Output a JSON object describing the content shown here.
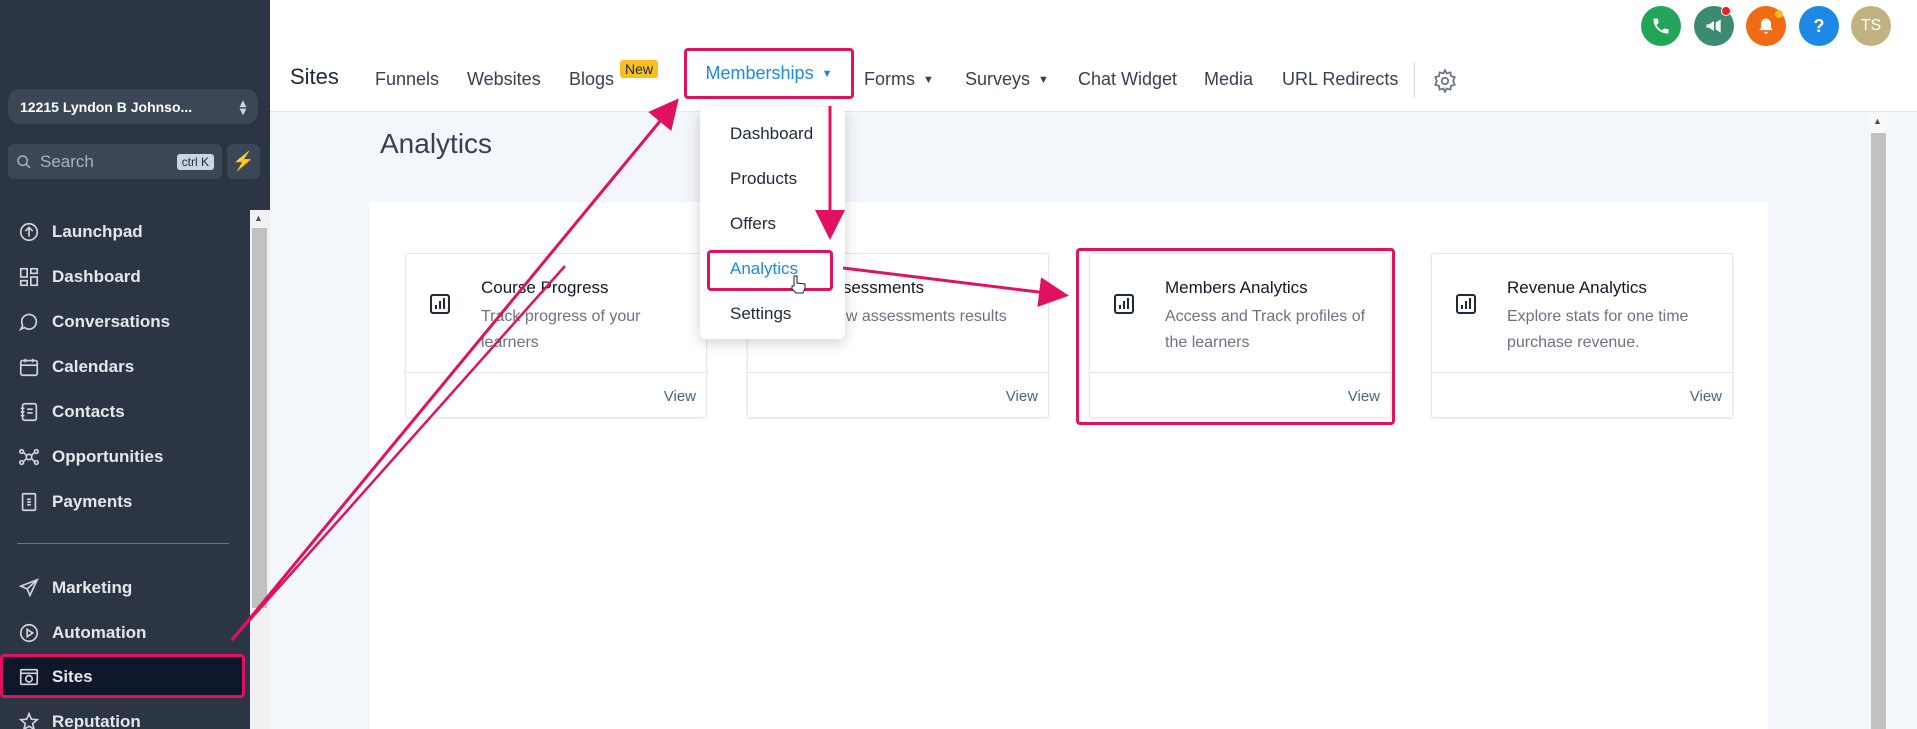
{
  "sidebar": {
    "location": "12215 Lyndon B Johnso...",
    "search_placeholder": "Search",
    "search_shortcut": "ctrl K",
    "items": [
      {
        "label": "Launchpad"
      },
      {
        "label": "Dashboard"
      },
      {
        "label": "Conversations"
      },
      {
        "label": "Calendars"
      },
      {
        "label": "Contacts"
      },
      {
        "label": "Opportunities"
      },
      {
        "label": "Payments"
      },
      {
        "label": "Marketing"
      },
      {
        "label": "Automation"
      },
      {
        "label": "Sites"
      },
      {
        "label": "Reputation"
      }
    ],
    "active_item": "Sites"
  },
  "header": {
    "title": "Sites",
    "tabs": [
      {
        "label": "Funnels"
      },
      {
        "label": "Websites"
      },
      {
        "label": "Blogs"
      },
      {
        "label": "Memberships"
      },
      {
        "label": "Forms"
      },
      {
        "label": "Surveys"
      },
      {
        "label": "Chat Widget"
      },
      {
        "label": "Media"
      },
      {
        "label": "URL Redirects"
      }
    ],
    "new_badge": "New",
    "active_tab": "Memberships",
    "avatar_initials": "TS"
  },
  "dropdown": {
    "items": [
      {
        "label": "Dashboard"
      },
      {
        "label": "Products"
      },
      {
        "label": "Offers"
      },
      {
        "label": "Analytics"
      },
      {
        "label": "Settings"
      }
    ],
    "active_item": "Analytics"
  },
  "main": {
    "title": "Analytics",
    "cards": [
      {
        "title": "Course Progress",
        "description": "Track progress of your learners",
        "action": "View"
      },
      {
        "title": "Assessments",
        "description": "View assessments results",
        "action": "View"
      },
      {
        "title": "Members Analytics",
        "description": "Access and Track profiles of the learners",
        "action": "View"
      },
      {
        "title": "Revenue Analytics",
        "description": "Explore stats for one time purchase revenue.",
        "action": "View"
      }
    ]
  },
  "colors": {
    "sidebar_bg": "#2b3544",
    "accent_blue": "#1e88e5",
    "annotation": "#e0115f",
    "new_badge": "#fbbf24",
    "phone_icon_bg": "#22a559",
    "megaphone_icon_bg": "#3b8b73",
    "bell_icon_bg": "#f36a14",
    "help_icon_bg": "#1e88e5",
    "avatar_bg": "#c2b280"
  }
}
